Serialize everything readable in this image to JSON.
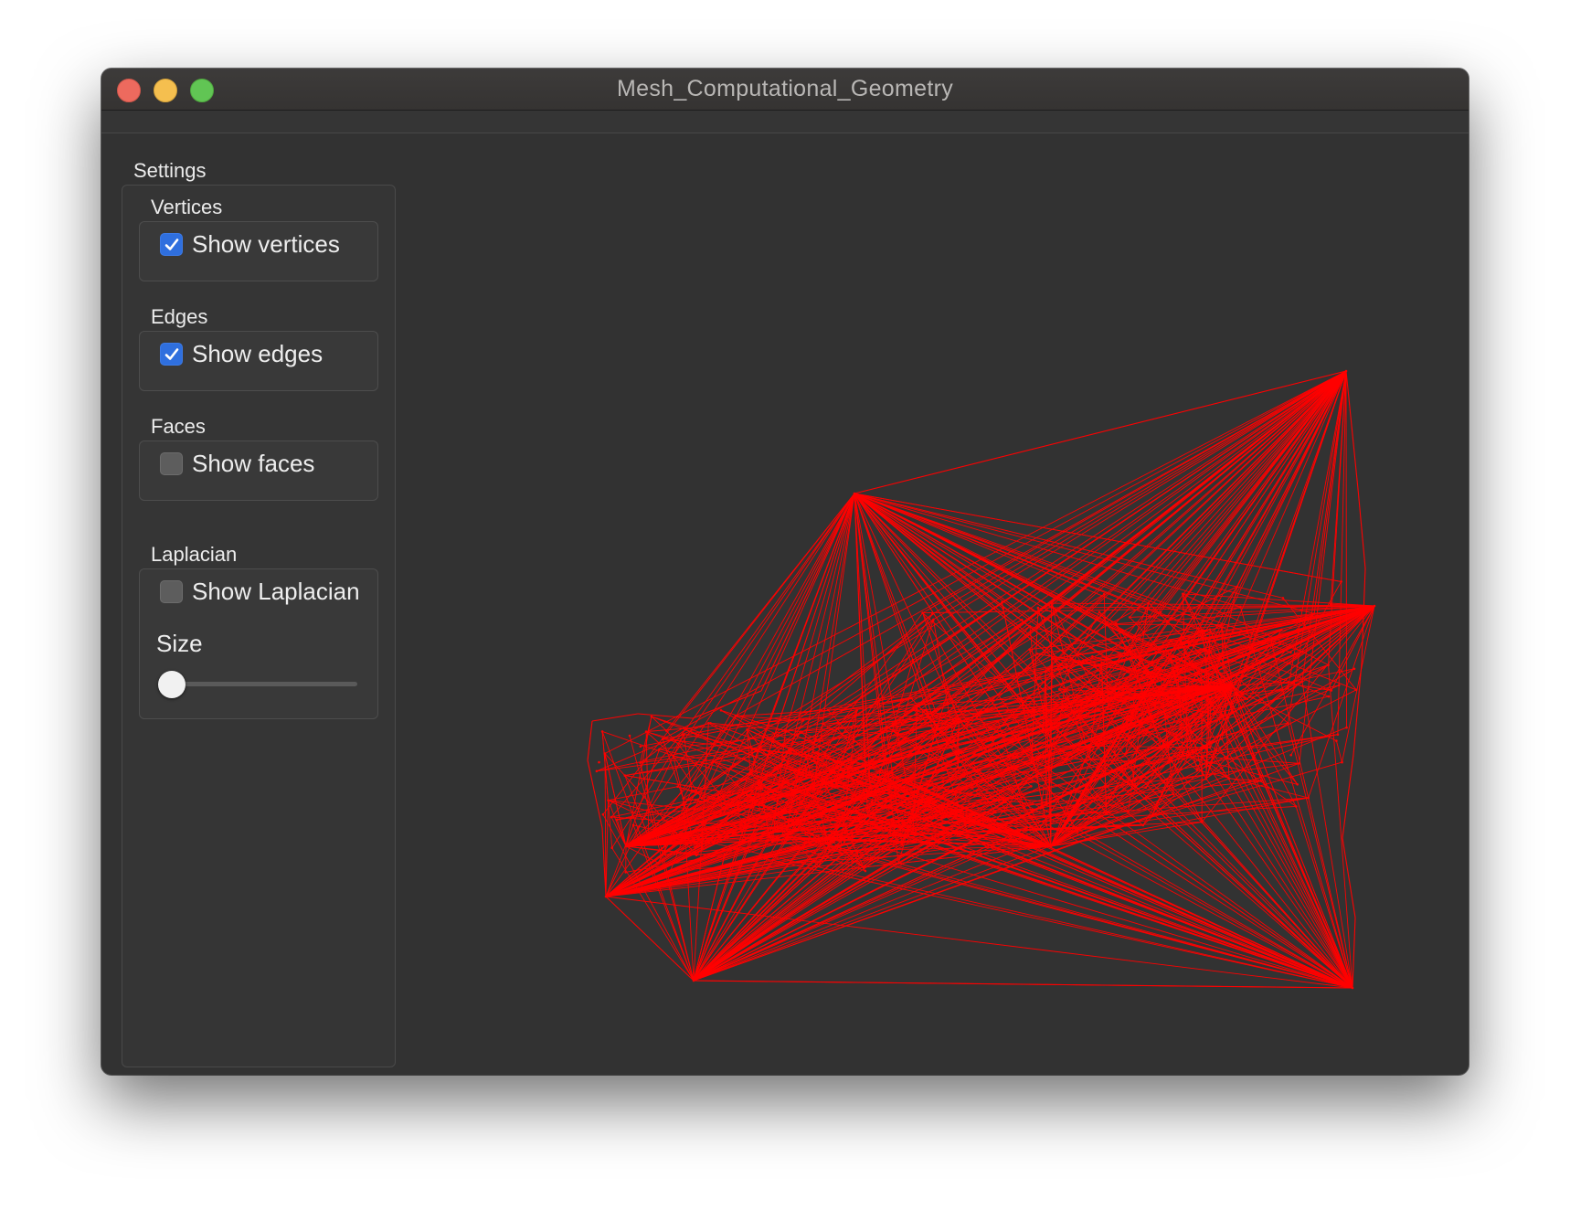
{
  "window": {
    "title": "Mesh_Computational_Geometry"
  },
  "settings": {
    "title": "Settings",
    "vertices": {
      "group_label": "Vertices",
      "checkbox_label": "Show vertices",
      "checked": true
    },
    "edges": {
      "group_label": "Edges",
      "checkbox_label": "Show edges",
      "checked": true
    },
    "faces": {
      "group_label": "Faces",
      "checkbox_label": "Show faces",
      "checked": false
    },
    "laplacian": {
      "group_label": "Laplacian",
      "checkbox_label": "Show Laplacian",
      "checked": false,
      "size_label": "Size",
      "size_value": 0
    }
  },
  "viewport": {
    "edge_color": "#ff0000",
    "background_color": "#323232"
  }
}
